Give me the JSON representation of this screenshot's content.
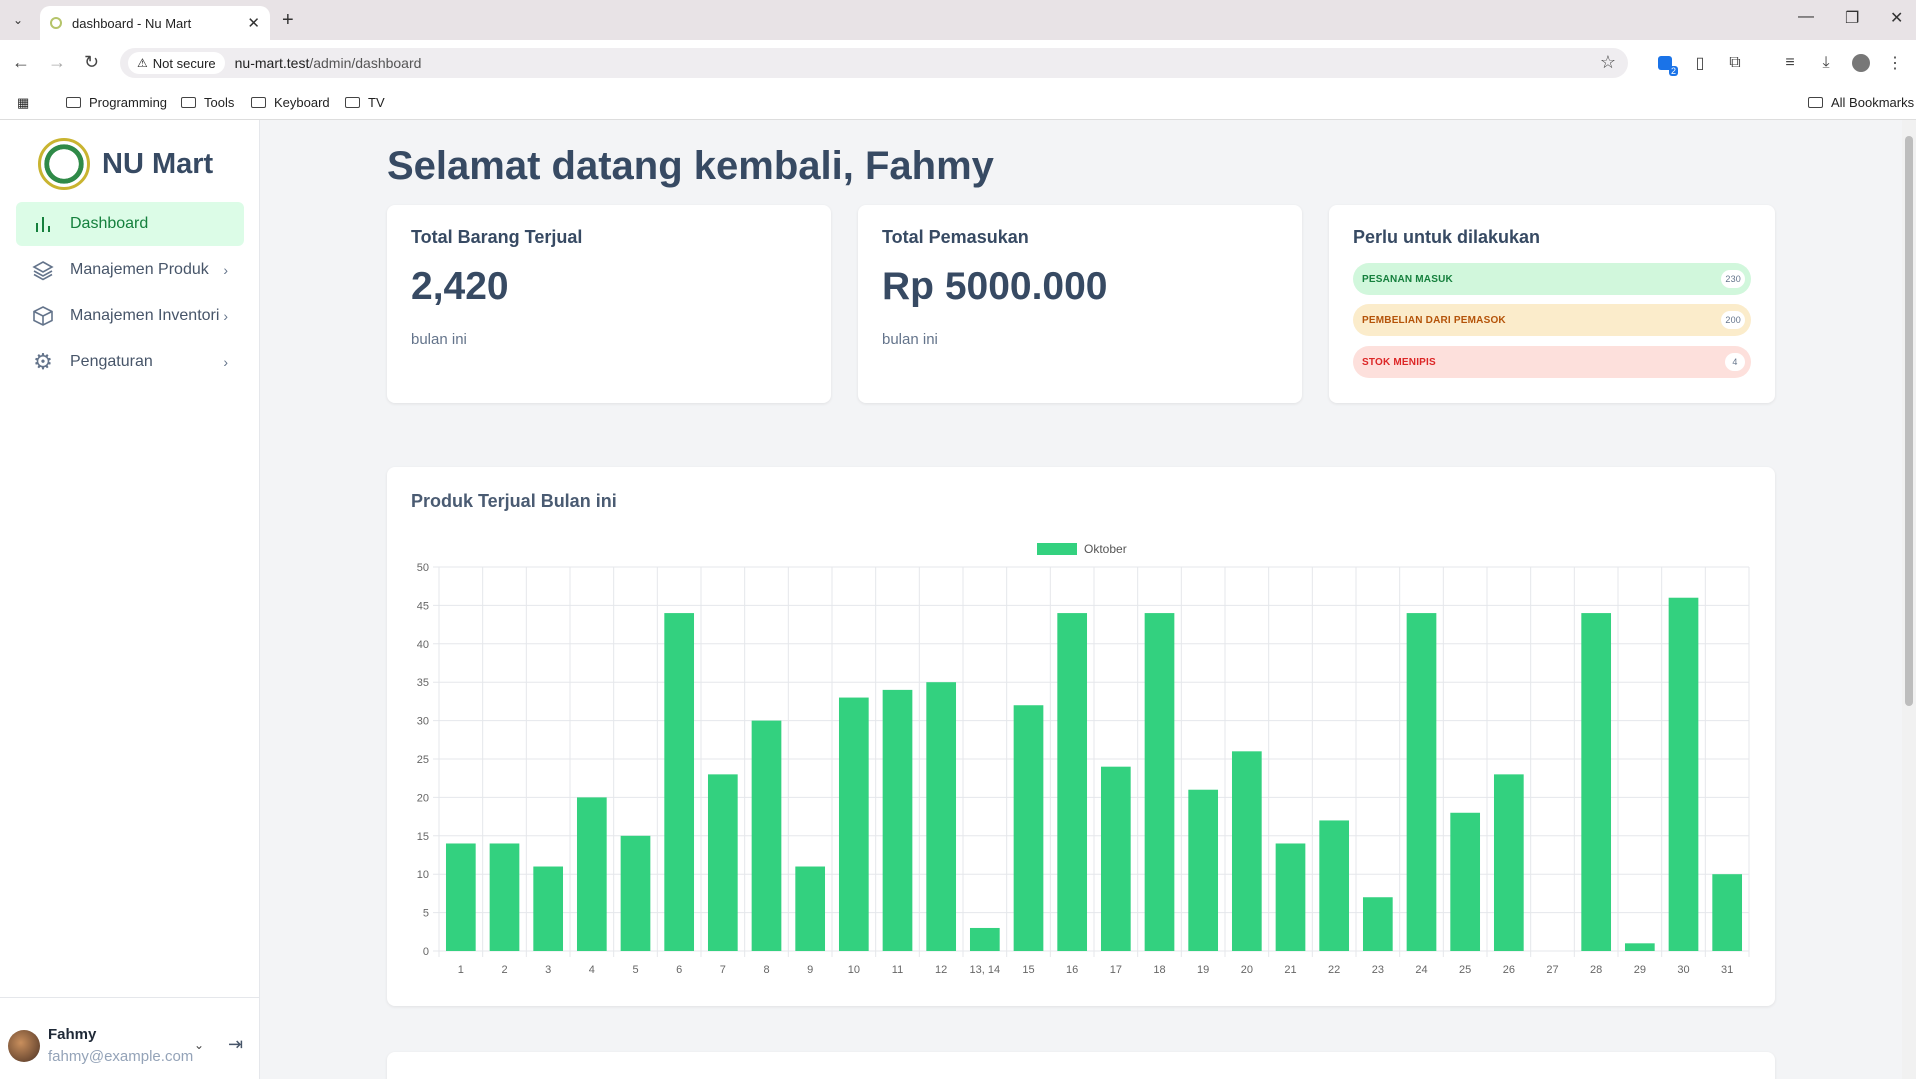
{
  "browser": {
    "tab_title": "dashboard - Nu Mart",
    "security_label": "Not secure",
    "url_host": "nu-mart.test",
    "url_path": "/admin/dashboard",
    "bookmarks": [
      "Programming",
      "Tools",
      "Keyboard",
      "TV"
    ],
    "all_bookmarks": "All Bookmarks",
    "extension_badge": "2"
  },
  "sidebar": {
    "brand": "NU Mart",
    "items": [
      {
        "label": "Dashboard",
        "icon": "bar-chart-icon",
        "active": true
      },
      {
        "label": "Manajemen Produk",
        "icon": "layers-icon"
      },
      {
        "label": "Manajemen Inventori",
        "icon": "box-icon"
      },
      {
        "label": "Pengaturan",
        "icon": "gear-icon"
      }
    ],
    "user": {
      "name": "Fahmy",
      "email": "fahmy@example.com"
    }
  },
  "main": {
    "welcome": "Selamat datang kembali, Fahmy",
    "stats": [
      {
        "title": "Total Barang Terjual",
        "value": "2,420",
        "caption": "bulan ini"
      },
      {
        "title": "Total Pemasukan",
        "value": "Rp 5000.000",
        "caption": "bulan ini"
      }
    ],
    "todo": {
      "title": "Perlu untuk dilakukan",
      "items": [
        {
          "label": "PESANAN MASUK",
          "count": "230",
          "color": "#15803d",
          "bg": "#d1f7dc"
        },
        {
          "label": "PEMBELIAN DARI PEMASOK",
          "count": "200",
          "color": "#b45309",
          "bg": "#fbeccb"
        },
        {
          "label": "STOK MENIPIS",
          "count": "4",
          "color": "#dc2626",
          "bg": "#fde0dc"
        }
      ]
    },
    "chart_title": "Produk Terjual Bulan ini"
  },
  "chart_data": {
    "type": "bar",
    "title": "",
    "xlabel": "",
    "ylabel": "",
    "ylim": [
      0,
      50
    ],
    "yticks": [
      0,
      5,
      10,
      15,
      20,
      25,
      30,
      35,
      40,
      45,
      50
    ],
    "grid": true,
    "legend_position": "top",
    "categories": [
      "1",
      "2",
      "3",
      "4",
      "5",
      "6",
      "7",
      "8",
      "9",
      "10",
      "11",
      "12",
      "13, 14",
      "15",
      "16",
      "17",
      "18",
      "19",
      "20",
      "21",
      "22",
      "23",
      "24",
      "25",
      "26",
      "27",
      "28",
      "29",
      "30",
      "31"
    ],
    "series": [
      {
        "name": "Oktober",
        "color": "#33d17f",
        "values": [
          14,
          14,
          11,
          20,
          15,
          44,
          23,
          30,
          11,
          33,
          34,
          35,
          3,
          32,
          44,
          24,
          44,
          21,
          26,
          14,
          17,
          7,
          44,
          18,
          23,
          0,
          44,
          1,
          46,
          10
        ]
      }
    ]
  }
}
